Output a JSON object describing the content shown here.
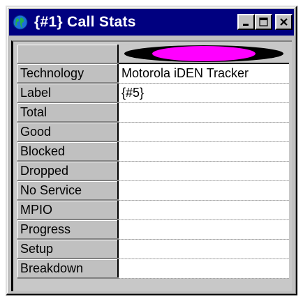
{
  "window": {
    "title": "{#1} Call Stats",
    "icon": "globe-icon",
    "buttons": [
      "minimize-icon",
      "maximize-icon",
      "close-icon"
    ]
  },
  "header": {
    "indicator_color": "#ff00ff"
  },
  "rows": [
    {
      "label": "Technology",
      "value": "Motorola iDEN Tracker"
    },
    {
      "label": "Label",
      "value": "{#5}"
    },
    {
      "label": "Total",
      "value": ""
    },
    {
      "label": "Good",
      "value": ""
    },
    {
      "label": "Blocked",
      "value": ""
    },
    {
      "label": "Dropped",
      "value": ""
    },
    {
      "label": "No Service",
      "value": ""
    },
    {
      "label": "MPIO",
      "value": ""
    },
    {
      "label": "Progress",
      "value": ""
    },
    {
      "label": "Setup",
      "value": ""
    },
    {
      "label": "Breakdown",
      "value": ""
    }
  ]
}
